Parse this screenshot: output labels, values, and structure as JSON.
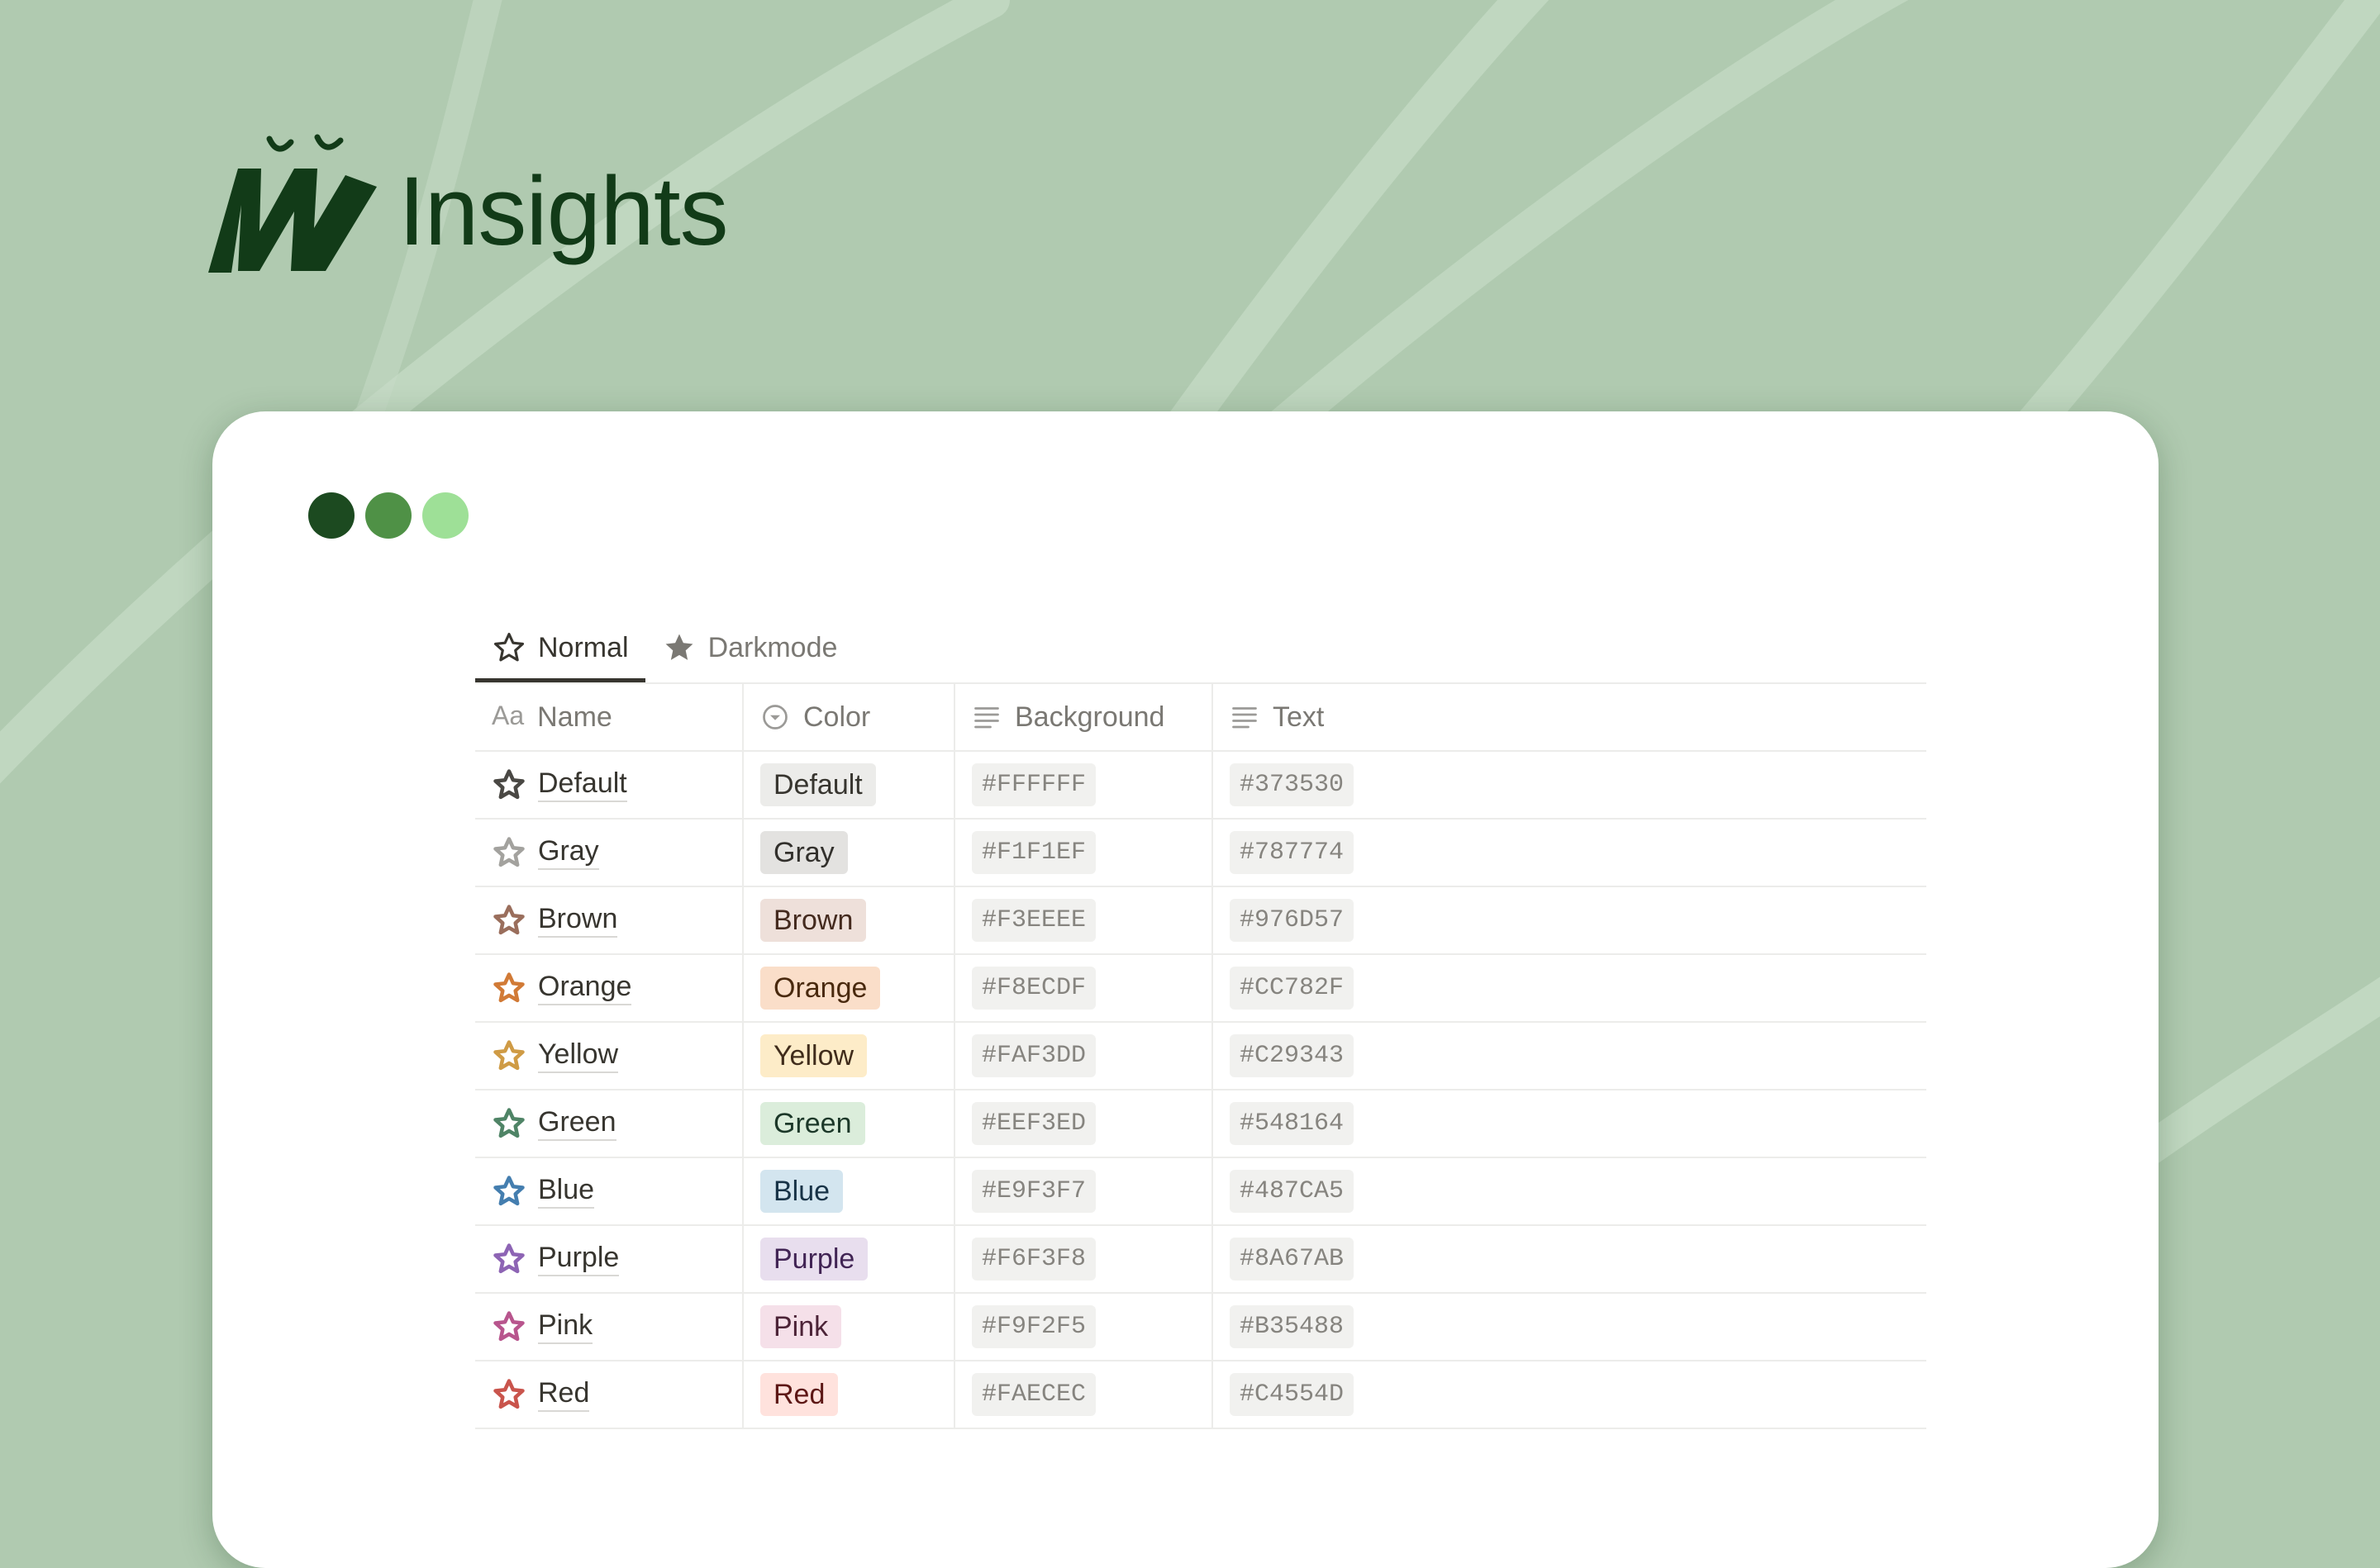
{
  "brand": {
    "name": "Insights"
  },
  "window_dots": [
    "#1c4a20",
    "#4f9146",
    "#9ee097"
  ],
  "tabs": [
    {
      "label": "Normal",
      "icon": "star-outline-icon",
      "active": true
    },
    {
      "label": "Darkmode",
      "icon": "star-filled-icon",
      "active": false
    }
  ],
  "columns": [
    {
      "label": "Name",
      "icon": "text-aa-icon"
    },
    {
      "label": "Color",
      "icon": "select-circle-icon"
    },
    {
      "label": "Background",
      "icon": "text-lines-icon"
    },
    {
      "label": "Text",
      "icon": "text-lines-icon"
    }
  ],
  "rows": [
    {
      "name": "Default",
      "color": "Default",
      "background": "#FFFFFF",
      "text": "#373530",
      "star_color": "#4a4844",
      "pill_bg": "#ececea",
      "pill_fg": "#37352f"
    },
    {
      "name": "Gray",
      "color": "Gray",
      "background": "#F1F1EF",
      "text": "#787774",
      "star_color": "#a3a29e",
      "pill_bg": "#e3e2e0",
      "pill_fg": "#32302c"
    },
    {
      "name": "Brown",
      "color": "Brown",
      "background": "#F3EEEE",
      "text": "#976D57",
      "star_color": "#9a6e5c",
      "pill_bg": "#eee0da",
      "pill_fg": "#442a1e"
    },
    {
      "name": "Orange",
      "color": "Orange",
      "background": "#F8ECDF",
      "text": "#CC782F",
      "star_color": "#d17a36",
      "pill_bg": "#fadec9",
      "pill_fg": "#49290e"
    },
    {
      "name": "Yellow",
      "color": "Yellow",
      "background": "#FAF3DD",
      "text": "#C29343",
      "star_color": "#cf9b45",
      "pill_bg": "#fdecc8",
      "pill_fg": "#402c1b"
    },
    {
      "name": "Green",
      "color": "Green",
      "background": "#EEF3ED",
      "text": "#548164",
      "star_color": "#4f8466",
      "pill_bg": "#dbeddb",
      "pill_fg": "#1c3829"
    },
    {
      "name": "Blue",
      "color": "Blue",
      "background": "#E9F3F7",
      "text": "#487CA5",
      "star_color": "#447eaf",
      "pill_bg": "#d3e5ef",
      "pill_fg": "#183347"
    },
    {
      "name": "Purple",
      "color": "Purple",
      "background": "#F6F3F8",
      "text": "#8A67AB",
      "star_color": "#8d64b4",
      "pill_bg": "#e8deee",
      "pill_fg": "#412454"
    },
    {
      "name": "Pink",
      "color": "Pink",
      "background": "#F9F2F5",
      "text": "#B35488",
      "star_color": "#b8558d",
      "pill_bg": "#f5e0e9",
      "pill_fg": "#4c2337"
    },
    {
      "name": "Red",
      "color": "Red",
      "background": "#FAECEC",
      "text": "#C4554D",
      "star_color": "#c9544c",
      "pill_bg": "#ffe2dd",
      "pill_fg": "#5d1715"
    }
  ]
}
